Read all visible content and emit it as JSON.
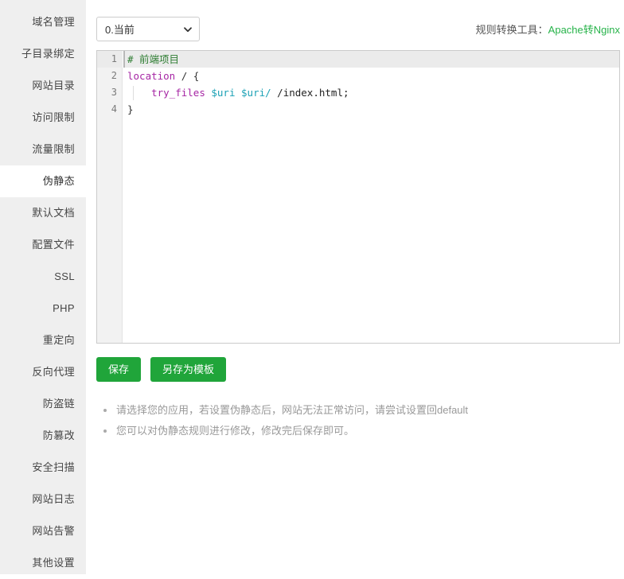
{
  "sidebar": {
    "items": [
      {
        "label": "域名管理",
        "active": false
      },
      {
        "label": "子目录绑定",
        "active": false
      },
      {
        "label": "网站目录",
        "active": false
      },
      {
        "label": "访问限制",
        "active": false
      },
      {
        "label": "流量限制",
        "active": false
      },
      {
        "label": "伪静态",
        "active": true
      },
      {
        "label": "默认文档",
        "active": false
      },
      {
        "label": "配置文件",
        "active": false
      },
      {
        "label": "SSL",
        "active": false
      },
      {
        "label": "PHP",
        "active": false
      },
      {
        "label": "重定向",
        "active": false
      },
      {
        "label": "反向代理",
        "active": false
      },
      {
        "label": "防盗链",
        "active": false
      },
      {
        "label": "防篡改",
        "active": false
      },
      {
        "label": "安全扫描",
        "active": false
      },
      {
        "label": "网站日志",
        "active": false
      },
      {
        "label": "网站告警",
        "active": false
      },
      {
        "label": "其他设置",
        "active": false
      }
    ]
  },
  "toolbar": {
    "template_select": {
      "value": "0.当前",
      "icon": "chevron-down-icon"
    },
    "converter": {
      "label": "规则转换工具：",
      "link_text": "Apache转Nginx",
      "link_color": "#27b34a"
    }
  },
  "editor": {
    "lines": [
      {
        "number": "1",
        "active": true,
        "tokens": [
          {
            "text": "# 前端项目",
            "type": "comment"
          }
        ]
      },
      {
        "number": "2",
        "active": false,
        "tokens": [
          {
            "text": "location",
            "type": "keyword"
          },
          {
            "text": " / {",
            "type": "punct"
          }
        ]
      },
      {
        "number": "3",
        "active": false,
        "indent_guide": true,
        "tokens": [
          {
            "text": "    ",
            "type": "plain"
          },
          {
            "text": "try_files",
            "type": "keyword"
          },
          {
            "text": " ",
            "type": "plain"
          },
          {
            "text": "$uri",
            "type": "var"
          },
          {
            "text": " ",
            "type": "plain"
          },
          {
            "text": "$uri/",
            "type": "var"
          },
          {
            "text": " /index.html;",
            "type": "plain"
          }
        ]
      },
      {
        "number": "4",
        "active": false,
        "tokens": [
          {
            "text": "}",
            "type": "punct"
          }
        ]
      }
    ]
  },
  "buttons": {
    "save_label": "保存",
    "save_as_template_label": "另存为模板",
    "color": "#20a53a"
  },
  "help": {
    "items": [
      "请选择您的应用，若设置伪静态后，网站无法正常访问，请尝试设置回default",
      "您可以对伪静态规则进行修改，修改完后保存即可。"
    ]
  }
}
